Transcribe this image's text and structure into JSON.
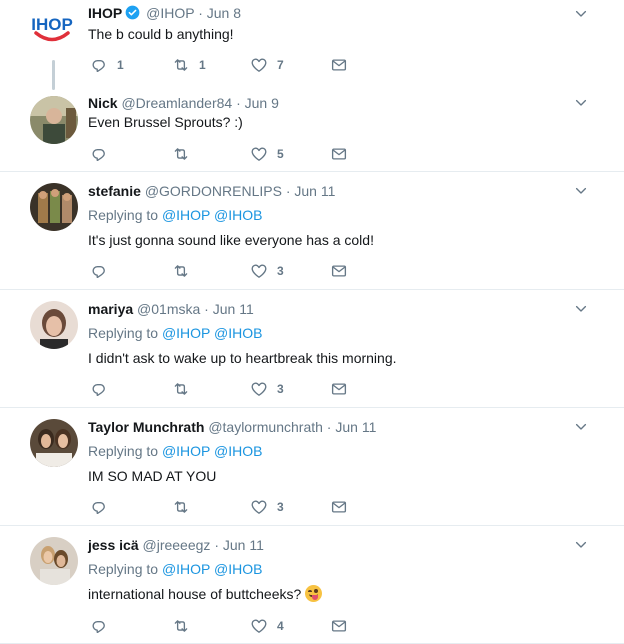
{
  "tweets": [
    {
      "name": "IHOP",
      "verified": true,
      "handle": "@IHOP",
      "dot": "·",
      "time": "Jun 8",
      "replying": null,
      "text": "The b could b anything!",
      "replies": "1",
      "retweets": "1",
      "likes": "7",
      "avatar_logo": "IHOP"
    },
    {
      "name": "Nick",
      "handle": "@Dreamlander84",
      "dot": "·",
      "time": "Jun 9",
      "replying": null,
      "text": "Even Brussel Sprouts? :)",
      "replies": "",
      "retweets": "",
      "likes": "5"
    },
    {
      "name": "stefanie",
      "handle": "@GORDONRENLIPS",
      "dot": "·",
      "time": "Jun 11",
      "replying": {
        "label": "Replying to",
        "m1": "@IHOP",
        "m2": "@IHOB"
      },
      "text": "It's just gonna sound like everyone has a cold!",
      "replies": "",
      "retweets": "",
      "likes": "3"
    },
    {
      "name": "mariya",
      "handle": "@01mska",
      "dot": "·",
      "time": "Jun 11",
      "replying": {
        "label": "Replying to",
        "m1": "@IHOP",
        "m2": "@IHOB"
      },
      "text": "I didn't ask to wake up to heartbreak this morning.",
      "replies": "",
      "retweets": "",
      "likes": "3"
    },
    {
      "name": "Taylor Munchrath",
      "handle": "@taylormunchrath",
      "dot": "·",
      "time": "Jun 11",
      "replying": {
        "label": "Replying to",
        "m1": "@IHOP",
        "m2": "@IHOB"
      },
      "text": "IM SO MAD AT YOU",
      "replies": "",
      "retweets": "",
      "likes": "3"
    },
    {
      "name": "jess icä",
      "handle": "@jreeeegz",
      "dot": "·",
      "time": "Jun 11",
      "replying": {
        "label": "Replying to",
        "m1": "@IHOP",
        "m2": "@IHOB"
      },
      "text": "international house of buttcheeks?",
      "replies": "",
      "retweets": "",
      "likes": "4"
    }
  ],
  "colors": {
    "link": "#1b95e0",
    "muted": "#657786",
    "text": "#14171a",
    "divider": "#e6ecf0",
    "ihop_blue": "#1565c0",
    "ihop_red": "#e0303a"
  },
  "icons": {
    "reply": "reply-icon",
    "retweet": "retweet-icon",
    "like": "heart-icon",
    "dm": "envelope-icon",
    "caret": "chevron-down-icon",
    "verified": "verified-badge-icon",
    "emoji": "face-savoring-food-emoji"
  }
}
